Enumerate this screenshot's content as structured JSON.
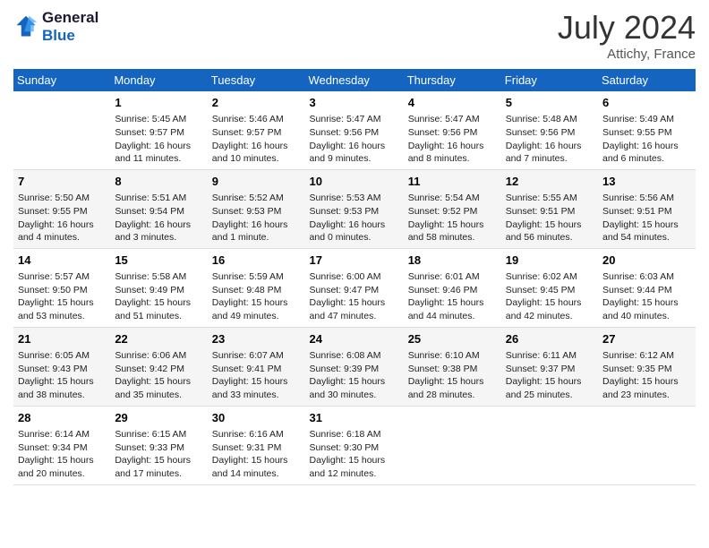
{
  "header": {
    "logo_line1": "General",
    "logo_line2": "Blue",
    "month": "July 2024",
    "location": "Attichy, France"
  },
  "weekdays": [
    "Sunday",
    "Monday",
    "Tuesday",
    "Wednesday",
    "Thursday",
    "Friday",
    "Saturday"
  ],
  "weeks": [
    [
      {
        "day": "",
        "info": ""
      },
      {
        "day": "1",
        "info": "Sunrise: 5:45 AM\nSunset: 9:57 PM\nDaylight: 16 hours\nand 11 minutes."
      },
      {
        "day": "2",
        "info": "Sunrise: 5:46 AM\nSunset: 9:57 PM\nDaylight: 16 hours\nand 10 minutes."
      },
      {
        "day": "3",
        "info": "Sunrise: 5:47 AM\nSunset: 9:56 PM\nDaylight: 16 hours\nand 9 minutes."
      },
      {
        "day": "4",
        "info": "Sunrise: 5:47 AM\nSunset: 9:56 PM\nDaylight: 16 hours\nand 8 minutes."
      },
      {
        "day": "5",
        "info": "Sunrise: 5:48 AM\nSunset: 9:56 PM\nDaylight: 16 hours\nand 7 minutes."
      },
      {
        "day": "6",
        "info": "Sunrise: 5:49 AM\nSunset: 9:55 PM\nDaylight: 16 hours\nand 6 minutes."
      }
    ],
    [
      {
        "day": "7",
        "info": "Sunrise: 5:50 AM\nSunset: 9:55 PM\nDaylight: 16 hours\nand 4 minutes."
      },
      {
        "day": "8",
        "info": "Sunrise: 5:51 AM\nSunset: 9:54 PM\nDaylight: 16 hours\nand 3 minutes."
      },
      {
        "day": "9",
        "info": "Sunrise: 5:52 AM\nSunset: 9:53 PM\nDaylight: 16 hours\nand 1 minute."
      },
      {
        "day": "10",
        "info": "Sunrise: 5:53 AM\nSunset: 9:53 PM\nDaylight: 16 hours\nand 0 minutes."
      },
      {
        "day": "11",
        "info": "Sunrise: 5:54 AM\nSunset: 9:52 PM\nDaylight: 15 hours\nand 58 minutes."
      },
      {
        "day": "12",
        "info": "Sunrise: 5:55 AM\nSunset: 9:51 PM\nDaylight: 15 hours\nand 56 minutes."
      },
      {
        "day": "13",
        "info": "Sunrise: 5:56 AM\nSunset: 9:51 PM\nDaylight: 15 hours\nand 54 minutes."
      }
    ],
    [
      {
        "day": "14",
        "info": "Sunrise: 5:57 AM\nSunset: 9:50 PM\nDaylight: 15 hours\nand 53 minutes."
      },
      {
        "day": "15",
        "info": "Sunrise: 5:58 AM\nSunset: 9:49 PM\nDaylight: 15 hours\nand 51 minutes."
      },
      {
        "day": "16",
        "info": "Sunrise: 5:59 AM\nSunset: 9:48 PM\nDaylight: 15 hours\nand 49 minutes."
      },
      {
        "day": "17",
        "info": "Sunrise: 6:00 AM\nSunset: 9:47 PM\nDaylight: 15 hours\nand 47 minutes."
      },
      {
        "day": "18",
        "info": "Sunrise: 6:01 AM\nSunset: 9:46 PM\nDaylight: 15 hours\nand 44 minutes."
      },
      {
        "day": "19",
        "info": "Sunrise: 6:02 AM\nSunset: 9:45 PM\nDaylight: 15 hours\nand 42 minutes."
      },
      {
        "day": "20",
        "info": "Sunrise: 6:03 AM\nSunset: 9:44 PM\nDaylight: 15 hours\nand 40 minutes."
      }
    ],
    [
      {
        "day": "21",
        "info": "Sunrise: 6:05 AM\nSunset: 9:43 PM\nDaylight: 15 hours\nand 38 minutes."
      },
      {
        "day": "22",
        "info": "Sunrise: 6:06 AM\nSunset: 9:42 PM\nDaylight: 15 hours\nand 35 minutes."
      },
      {
        "day": "23",
        "info": "Sunrise: 6:07 AM\nSunset: 9:41 PM\nDaylight: 15 hours\nand 33 minutes."
      },
      {
        "day": "24",
        "info": "Sunrise: 6:08 AM\nSunset: 9:39 PM\nDaylight: 15 hours\nand 30 minutes."
      },
      {
        "day": "25",
        "info": "Sunrise: 6:10 AM\nSunset: 9:38 PM\nDaylight: 15 hours\nand 28 minutes."
      },
      {
        "day": "26",
        "info": "Sunrise: 6:11 AM\nSunset: 9:37 PM\nDaylight: 15 hours\nand 25 minutes."
      },
      {
        "day": "27",
        "info": "Sunrise: 6:12 AM\nSunset: 9:35 PM\nDaylight: 15 hours\nand 23 minutes."
      }
    ],
    [
      {
        "day": "28",
        "info": "Sunrise: 6:14 AM\nSunset: 9:34 PM\nDaylight: 15 hours\nand 20 minutes."
      },
      {
        "day": "29",
        "info": "Sunrise: 6:15 AM\nSunset: 9:33 PM\nDaylight: 15 hours\nand 17 minutes."
      },
      {
        "day": "30",
        "info": "Sunrise: 6:16 AM\nSunset: 9:31 PM\nDaylight: 15 hours\nand 14 minutes."
      },
      {
        "day": "31",
        "info": "Sunrise: 6:18 AM\nSunset: 9:30 PM\nDaylight: 15 hours\nand 12 minutes."
      },
      {
        "day": "",
        "info": ""
      },
      {
        "day": "",
        "info": ""
      },
      {
        "day": "",
        "info": ""
      }
    ]
  ]
}
